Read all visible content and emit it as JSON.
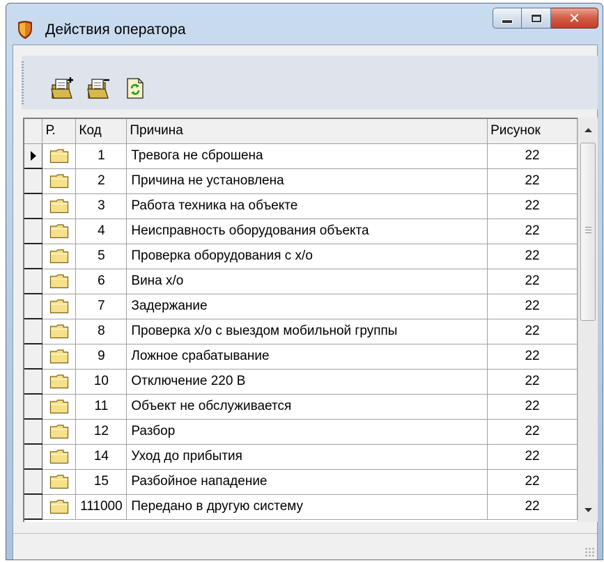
{
  "window": {
    "title": "Действия оператора"
  },
  "toolbar": {
    "buttons": [
      {
        "icon": "add-document-icon"
      },
      {
        "icon": "remove-document-icon"
      },
      {
        "icon": "refresh-document-icon"
      }
    ]
  },
  "grid": {
    "columns": {
      "r": "Р.",
      "code": "Код",
      "reason": "Причина",
      "picture": "Рисунок"
    },
    "rows": [
      {
        "code": "1",
        "reason": "Тревога не сброшена",
        "picture": "22"
      },
      {
        "code": "2",
        "reason": "Причина не установлена",
        "picture": "22"
      },
      {
        "code": "3",
        "reason": "Работа техника на объекте",
        "picture": "22"
      },
      {
        "code": "4",
        "reason": "Неисправность оборудования объекта",
        "picture": "22"
      },
      {
        "code": "5",
        "reason": "Проверка оборудования с х/о",
        "picture": "22"
      },
      {
        "code": "6",
        "reason": "Вина х/о",
        "picture": "22"
      },
      {
        "code": "7",
        "reason": "Задержание",
        "picture": "22"
      },
      {
        "code": "8",
        "reason": "Проверка х/о с выездом мобильной группы",
        "picture": "22"
      },
      {
        "code": "9",
        "reason": "Ложное срабатывание",
        "picture": "22"
      },
      {
        "code": "10",
        "reason": "Отключение 220 В",
        "picture": "22"
      },
      {
        "code": "11",
        "reason": "Объект не обслуживается",
        "picture": "22"
      },
      {
        "code": "12",
        "reason": "Разбор",
        "picture": "22"
      },
      {
        "code": "14",
        "reason": "Уход до прибытия",
        "picture": "22"
      },
      {
        "code": "15",
        "reason": "Разбойное нападение",
        "picture": "22"
      },
      {
        "code": "111000",
        "reason": "Передано в другую систему",
        "picture": "22"
      }
    ],
    "selected_row": 0
  },
  "colors": {
    "folder": "#f7e08a",
    "shield": "#d35a12"
  }
}
